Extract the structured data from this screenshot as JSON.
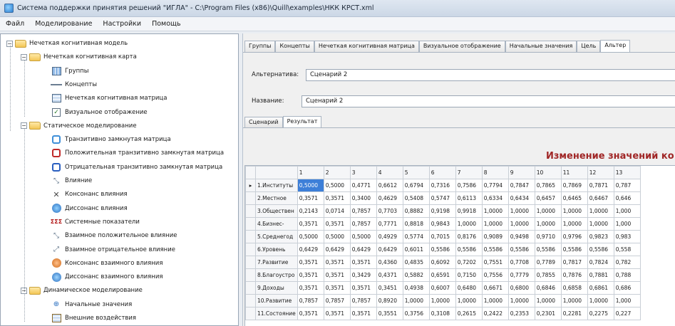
{
  "window": {
    "title": "Система поддержки принятия решений \"ИГЛА\" - C:\\Program Files (x86)\\Quill\\examples\\НКК КРСТ.xml"
  },
  "menu": [
    "Файл",
    "Моделирование",
    "Настройки",
    "Помощь"
  ],
  "tree": [
    {
      "label": "Нечеткая когнитивная модель",
      "level": 0,
      "icon": "folder-icon",
      "expander": "−"
    },
    {
      "label": "Нечеткая когнитивная карта",
      "level": 1,
      "icon": "folder-icon",
      "expander": "−"
    },
    {
      "label": "Группы",
      "level": 2,
      "icon": "groups-icon"
    },
    {
      "label": "Концепты",
      "level": 2,
      "icon": "concepts-icon"
    },
    {
      "label": "Нечеткая когнитивная матрица",
      "level": 2,
      "icon": "matrix-icon"
    },
    {
      "label": "Визуальное отображение",
      "level": 2,
      "icon": "visual-icon"
    },
    {
      "label": "Статическое моделирование",
      "level": 1,
      "icon": "folder-icon",
      "expander": "−"
    },
    {
      "label": "Транзитивно замкнутая матрица",
      "level": 2,
      "icon": "closure-matrix-icon"
    },
    {
      "label": "Положительная транзитивно замкнутая матрица",
      "level": 2,
      "icon": "positive-matrix-icon"
    },
    {
      "label": "Отрицательная транзитивно замкнутая матрица",
      "level": 2,
      "icon": "negative-matrix-icon"
    },
    {
      "label": "Влияние",
      "level": 2,
      "icon": "influence-icon"
    },
    {
      "label": "Консонанс влияния",
      "level": 2,
      "icon": "consonance-icon"
    },
    {
      "label": "Диссонанс влияния",
      "level": 2,
      "icon": "dissonance-icon"
    },
    {
      "label": "Системные показатели",
      "level": 2,
      "icon": "system-indicators-icon"
    },
    {
      "label": "Взаимное положительное влияние",
      "level": 2,
      "icon": "mutual-positive-icon"
    },
    {
      "label": "Взаимное отрицательное влияние",
      "level": 2,
      "icon": "mutual-negative-icon"
    },
    {
      "label": "Консонанс взаимного влияния",
      "level": 2,
      "icon": "mutual-consonance-icon"
    },
    {
      "label": "Диссонанс взаимного влияния",
      "level": 2,
      "icon": "mutual-dissonance-icon"
    },
    {
      "label": "Динамическое моделирование",
      "level": 1,
      "icon": "folder-icon",
      "expander": "−"
    },
    {
      "label": "Начальные значения",
      "level": 2,
      "icon": "initial-values-icon"
    },
    {
      "label": "Внешние воздействия",
      "level": 2,
      "icon": "external-impacts-icon"
    }
  ],
  "tabs": [
    "Группы",
    "Концепты",
    "Нечеткая когнитивная матрица",
    "Визуальное отображение",
    "Начальные значения",
    "Цель",
    "Альтер"
  ],
  "active_tab": 6,
  "form": {
    "alt_label": "Альтернатива:",
    "alt_value": "Сценарий 2",
    "name_label": "Название:",
    "name_value": "Сценарий 2"
  },
  "subtabs": [
    "Сценарий",
    "Результат"
  ],
  "active_subtab": 1,
  "result_heading": "Изменение значений ко",
  "grid": {
    "columns": [
      "1",
      "2",
      "3",
      "4",
      "5",
      "6",
      "7",
      "8",
      "9",
      "10",
      "11",
      "12",
      "13"
    ],
    "rows": [
      {
        "name": "1.Институты",
        "current": true,
        "values": [
          "0,5000",
          "0,5000",
          "0,4771",
          "0,6612",
          "0,6794",
          "0,7316",
          "0,7586",
          "0,7794",
          "0,7847",
          "0,7865",
          "0,7869",
          "0,7871",
          "0,787"
        ]
      },
      {
        "name": "2.Местное",
        "values": [
          "0,3571",
          "0,3571",
          "0,3400",
          "0,4629",
          "0,5408",
          "0,5747",
          "0,6113",
          "0,6334",
          "0,6434",
          "0,6457",
          "0,6465",
          "0,6467",
          "0,646"
        ]
      },
      {
        "name": "3.Обществен",
        "values": [
          "0,2143",
          "0,0714",
          "0,7857",
          "0,7703",
          "0,8882",
          "0,9198",
          "0,9918",
          "1,0000",
          "1,0000",
          "1,0000",
          "1,0000",
          "1,0000",
          "1,000"
        ]
      },
      {
        "name": "4.Бизнес-",
        "values": [
          "0,3571",
          "0,3571",
          "0,7857",
          "0,7771",
          "0,8818",
          "0,9843",
          "1,0000",
          "1,0000",
          "1,0000",
          "1,0000",
          "1,0000",
          "1,0000",
          "1,000"
        ]
      },
      {
        "name": "5.Среднегод",
        "values": [
          "0,5000",
          "0,5000",
          "0,5000",
          "0,4929",
          "0,5774",
          "0,7015",
          "0,8176",
          "0,9089",
          "0,9498",
          "0,9710",
          "0,9796",
          "0,9823",
          "0,983"
        ]
      },
      {
        "name": "6.Уровень",
        "values": [
          "0,6429",
          "0,6429",
          "0,6429",
          "0,6429",
          "0,6011",
          "0,5586",
          "0,5586",
          "0,5586",
          "0,5586",
          "0,5586",
          "0,5586",
          "0,5586",
          "0,558"
        ]
      },
      {
        "name": "7.Развитие",
        "values": [
          "0,3571",
          "0,3571",
          "0,3571",
          "0,4360",
          "0,4835",
          "0,6092",
          "0,7202",
          "0,7551",
          "0,7708",
          "0,7789",
          "0,7817",
          "0,7824",
          "0,782"
        ]
      },
      {
        "name": "8.Благоустро",
        "values": [
          "0,3571",
          "0,3571",
          "0,3429",
          "0,4371",
          "0,5882",
          "0,6591",
          "0,7150",
          "0,7556",
          "0,7779",
          "0,7855",
          "0,7876",
          "0,7881",
          "0,788"
        ]
      },
      {
        "name": "9.Доходы",
        "values": [
          "0,3571",
          "0,3571",
          "0,3571",
          "0,3451",
          "0,4938",
          "0,6007",
          "0,6480",
          "0,6671",
          "0,6800",
          "0,6846",
          "0,6858",
          "0,6861",
          "0,686"
        ]
      },
      {
        "name": "10.Развитие",
        "values": [
          "0,7857",
          "0,7857",
          "0,7857",
          "0,8920",
          "1,0000",
          "1,0000",
          "1,0000",
          "1,0000",
          "1,0000",
          "1,0000",
          "1,0000",
          "1,0000",
          "1,000"
        ]
      },
      {
        "name": "11.Состояние",
        "values": [
          "0,3571",
          "0,3571",
          "0,3571",
          "0,3551",
          "0,3756",
          "0,3108",
          "0,2615",
          "0,2422",
          "0,2353",
          "0,2301",
          "0,2281",
          "0,2275",
          "0,227"
        ]
      }
    ]
  },
  "colors": {
    "accent": "#3d7fd8",
    "heading": "#a02626"
  }
}
